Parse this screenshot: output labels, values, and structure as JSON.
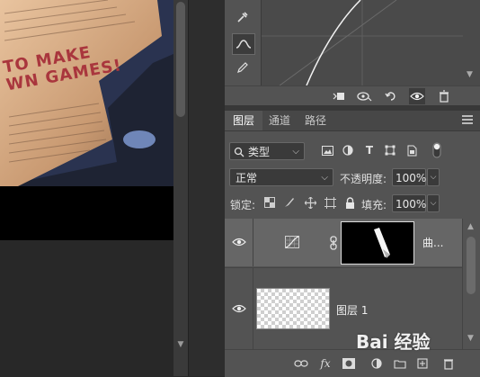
{
  "canvas": {
    "photo_text_line1": "TO MAKE",
    "photo_text_line2": "WN GAMES!"
  },
  "properties_bar": {
    "icons": [
      "clip-to-layer-icon",
      "view-previous-icon",
      "reset-icon",
      "visibility-icon",
      "trash-icon"
    ]
  },
  "tabs": [
    {
      "label": "图层",
      "active": true
    },
    {
      "label": "通道",
      "active": false
    },
    {
      "label": "路径",
      "active": false
    }
  ],
  "filter": {
    "kind_label": "类型",
    "icons": [
      "image-filter-icon",
      "adjustment-filter-icon",
      "type-filter-icon",
      "shape-filter-icon",
      "smart-object-filter-icon",
      "filter-toggle-icon"
    ]
  },
  "blend": {
    "mode": "正常",
    "opacity_label": "不透明度:",
    "opacity_value": "100%"
  },
  "lock": {
    "label": "锁定:",
    "fill_label": "填充:",
    "fill_value": "100%"
  },
  "layers": [
    {
      "name": "曲...",
      "type": "curves-adjustment"
    },
    {
      "name": "图层 1",
      "type": "pixel"
    }
  ],
  "bottom_bar": {
    "fx_label": "fx"
  },
  "watermark": {
    "text": "Bai 经验"
  },
  "colors": {
    "panel_bg": "#535353",
    "selected_layer_bg": "#666666",
    "canvas_bg": "#282828"
  }
}
